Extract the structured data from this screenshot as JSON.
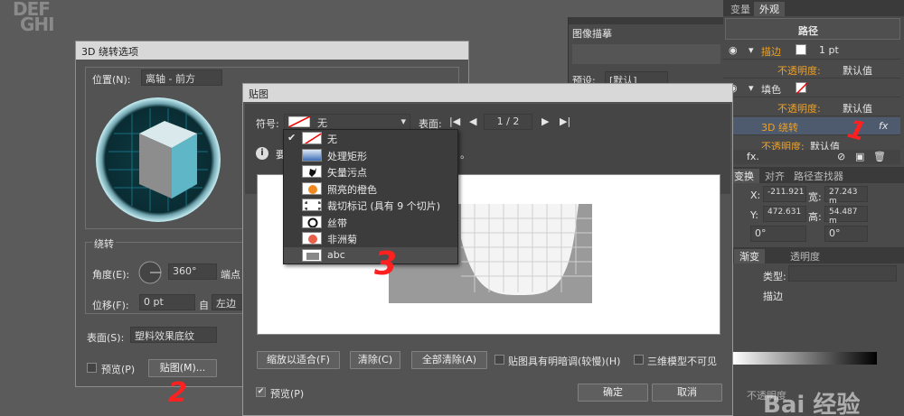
{
  "logo": {
    "line1": "DEF",
    "line2": "GHI"
  },
  "dialog3d": {
    "title": "3D 绕转选项",
    "position_label": "位置(N):",
    "position_value": "离轴 - 前方",
    "revolve_label": "绕转",
    "angle_label": "角度(E):",
    "angle_value": "360°",
    "cap_label": "端点",
    "offset_label": "位移(F):",
    "offset_value": "0 pt",
    "from_label": "自",
    "from_value": "左边",
    "surface_label": "表面(S):",
    "surface_value": "塑料效果底纹",
    "preview_label": "预览(P)",
    "map_button": "贴图(M)..."
  },
  "image_trace": {
    "title": "图像描摹",
    "preset_label": "预设:",
    "preset_value": "[默认]"
  },
  "right_panel": {
    "tabs": [
      "变量",
      "外观"
    ],
    "path_label": "路径",
    "rows": [
      {
        "label": "描边",
        "value": "1 pt"
      },
      {
        "label": "不透明度:",
        "value": "默认值"
      },
      {
        "label": "填色",
        "value": ""
      },
      {
        "label": "不透明度:",
        "value": "默认值"
      },
      {
        "label": "3D 绕转",
        "value": "fx"
      },
      {
        "label": "不透明度:",
        "value": "默认值"
      }
    ],
    "fx_label": "fx.",
    "transform_tabs": [
      "变换",
      "对齐",
      "路径查找器"
    ],
    "x_label": "X:",
    "x_value": "-211.921",
    "w_label": "宽:",
    "w_value": "27.243 m",
    "y_label": "Y:",
    "y_value": "472.631",
    "h_label": "高:",
    "h_value": "54.487 m",
    "angle1": "0°",
    "angle2": "0°",
    "gradient_tabs": [
      "渐变",
      "透明度"
    ],
    "type_label": "类型:",
    "stroke_label": "描边",
    "opacity_label": "不透明度"
  },
  "map_dialog": {
    "title": "贴图",
    "symbol_label": "符号:",
    "symbol_value": "无",
    "surface_label": "表面:",
    "surface_page": "1 / 2",
    "info_char": "要",
    "info_tail": "。",
    "dropdown_items": [
      {
        "label": "无",
        "swatch": "none",
        "checked": "✔"
      },
      {
        "label": "处理矩形",
        "swatch": "blue"
      },
      {
        "label": "矢量污点",
        "swatch": "splat"
      },
      {
        "label": "照亮的橙色",
        "swatch": "orange"
      },
      {
        "label": "裁切标记 (具有 9 个切片)",
        "swatch": "crop"
      },
      {
        "label": "丝带",
        "swatch": "ribbon"
      },
      {
        "label": "非洲菊",
        "swatch": "flower"
      },
      {
        "label": "abc",
        "swatch": "abc"
      }
    ],
    "fit_button": "缩放以适合(F)",
    "clear_button": "清除(C)",
    "clear_all_button": "全部清除(A)",
    "shade_label": "贴图具有明暗调(较慢)(H)",
    "invisible_label": "三维模型不可见",
    "preview_label": "预览(P)",
    "ok_button": "确定",
    "cancel_button": "取消"
  },
  "annotations": {
    "one": "1",
    "two": "2",
    "three": "3"
  },
  "watermark": "Bai 经验"
}
